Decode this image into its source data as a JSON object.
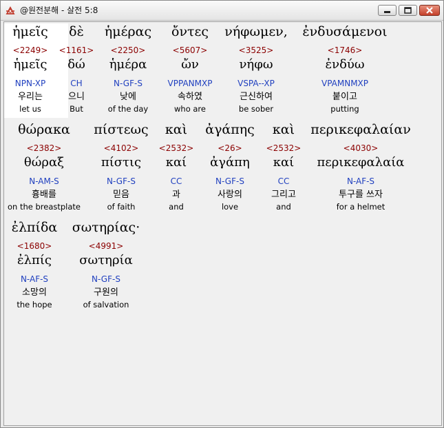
{
  "window": {
    "title": "@원전분해 - 살전 5:8",
    "buttons": {
      "minimize": "minimize",
      "maximize": "maximize",
      "close": "close"
    }
  },
  "words": [
    {
      "greek": "ἡμεῖς",
      "strong": "<2249>",
      "lemma": "ἡμεῖς",
      "morph": "NPN-XP",
      "korean": "우리는",
      "english": "let us"
    },
    {
      "greek": "δὲ",
      "strong": "<1161>",
      "lemma": "δώ",
      "morph": "CH",
      "korean": "으니",
      "english": "But"
    },
    {
      "greek": "ἡμέρας",
      "strong": "<2250>",
      "lemma": "ἡμέρα",
      "morph": "N-GF-S",
      "korean": "낮에",
      "english": "of the day"
    },
    {
      "greek": "ὄντες",
      "strong": "<5607>",
      "lemma": "ὤν",
      "morph": "VPPANMXP",
      "korean": "속하였",
      "english": "who are"
    },
    {
      "greek": "νήφωμεν,",
      "strong": "<3525>",
      "lemma": "νήφω",
      "morph": "VSPA--XP",
      "korean": "근신하여",
      "english": "be sober"
    },
    {
      "greek": "ἐνδυσάμενοι",
      "strong": "<1746>",
      "lemma": "ἐνδύω",
      "morph": "VPAMNMXP",
      "korean": "붙이고",
      "english": "putting"
    },
    {
      "greek": "θώρακα",
      "strong": "<2382>",
      "lemma": "θώραξ",
      "morph": "N-AM-S",
      "korean": "흉배를",
      "english": "on the breastplate"
    },
    {
      "greek": "πίστεως",
      "strong": "<4102>",
      "lemma": "πίστις",
      "morph": "N-GF-S",
      "korean": "믿음",
      "english": "of faith"
    },
    {
      "greek": "καὶ",
      "strong": "<2532>",
      "lemma": "καί",
      "morph": "CC",
      "korean": "과",
      "english": "and"
    },
    {
      "greek": "ἀγάπης",
      "strong": "<26>",
      "lemma": "ἀγάπη",
      "morph": "N-GF-S",
      "korean": "사랑의",
      "english": "love"
    },
    {
      "greek": "καὶ",
      "strong": "<2532>",
      "lemma": "καί",
      "morph": "CC",
      "korean": "그리고",
      "english": "and"
    },
    {
      "greek": "περικεφαλαίαν",
      "strong": "<4030>",
      "lemma": "περικεφαλαία",
      "morph": "N-AF-S",
      "korean": "투구를 쓰자",
      "english": "for a helmet"
    },
    {
      "greek": "ἐλπίδα",
      "strong": "<1680>",
      "lemma": "ἐλπίς",
      "morph": "N-AF-S",
      "korean": "소망의",
      "english": "the hope"
    },
    {
      "greek": "σωτηρίας·",
      "strong": "<4991>",
      "lemma": "σωτηρία",
      "morph": "N-GF-S",
      "korean": "구원의",
      "english": "of salvation"
    }
  ]
}
